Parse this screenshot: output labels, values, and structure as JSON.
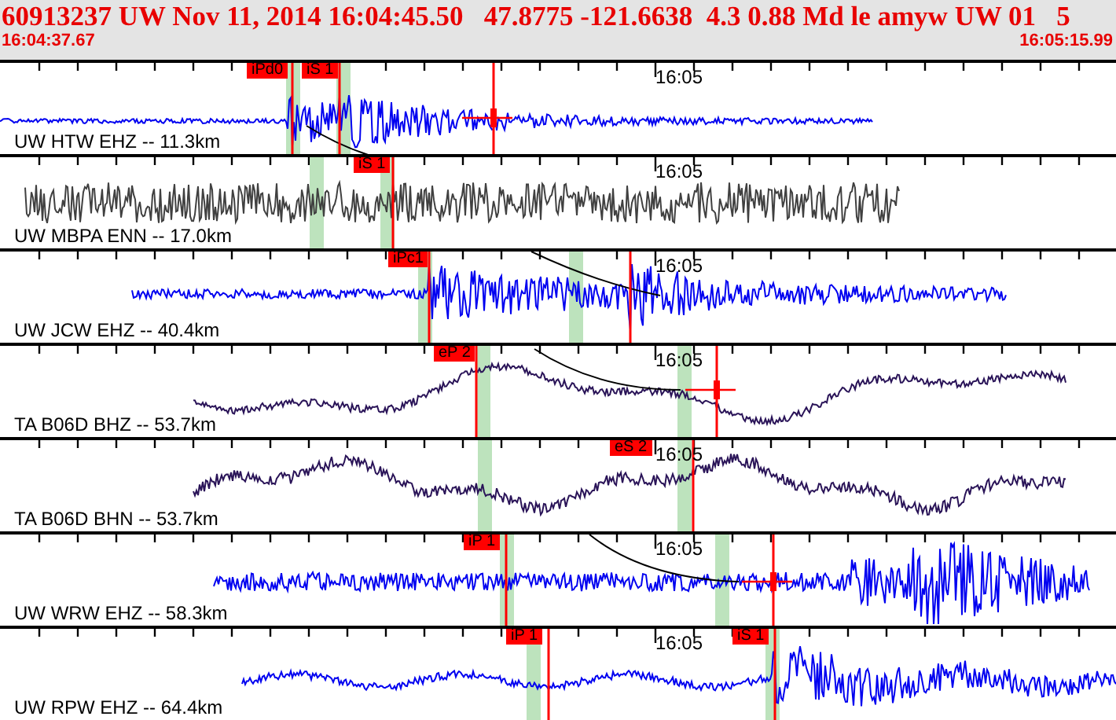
{
  "header": {
    "event_line": "60913237 UW Nov 11, 2014 16:04:45.50   47.8775 -121.6638  4.3 0.88 Md le amyw UW 01   5",
    "start_time": "16:04:37.67",
    "end_time": "16:05:15.99"
  },
  "traces": [
    {
      "station": "UW HTW EHZ -- 11.3km",
      "kind": "short_period",
      "time_label": "16:05",
      "picks": [
        {
          "label": "iPd0"
        },
        {
          "label": "iS 1"
        }
      ]
    },
    {
      "station": "UW MBPA ENN -- 17.0km",
      "kind": "strong_motion",
      "time_label": "16:05",
      "picks": [
        {
          "label": "iS 1"
        }
      ]
    },
    {
      "station": "UW JCW EHZ -- 40.4km",
      "kind": "short_period",
      "time_label": "16:05",
      "picks": [
        {
          "label": "iPc1"
        }
      ]
    },
    {
      "station": "TA B06D BHZ -- 53.7km",
      "kind": "broadband",
      "time_label": "16:05",
      "picks": [
        {
          "label": "eP 2"
        }
      ]
    },
    {
      "station": "TA B06D BHN -- 53.7km",
      "kind": "broadband",
      "time_label": "16:05",
      "picks": [
        {
          "label": "eS 2"
        }
      ]
    },
    {
      "station": "UW WRW EHZ -- 58.3km",
      "kind": "short_period",
      "time_label": "16:05",
      "picks": [
        {
          "label": "iP 1"
        }
      ]
    },
    {
      "station": "UW RPW EHZ -- 64.4km",
      "kind": "short_period",
      "time_label": "16:05",
      "picks": [
        {
          "label": "iP 1"
        },
        {
          "label": "iS 1"
        }
      ]
    }
  ]
}
